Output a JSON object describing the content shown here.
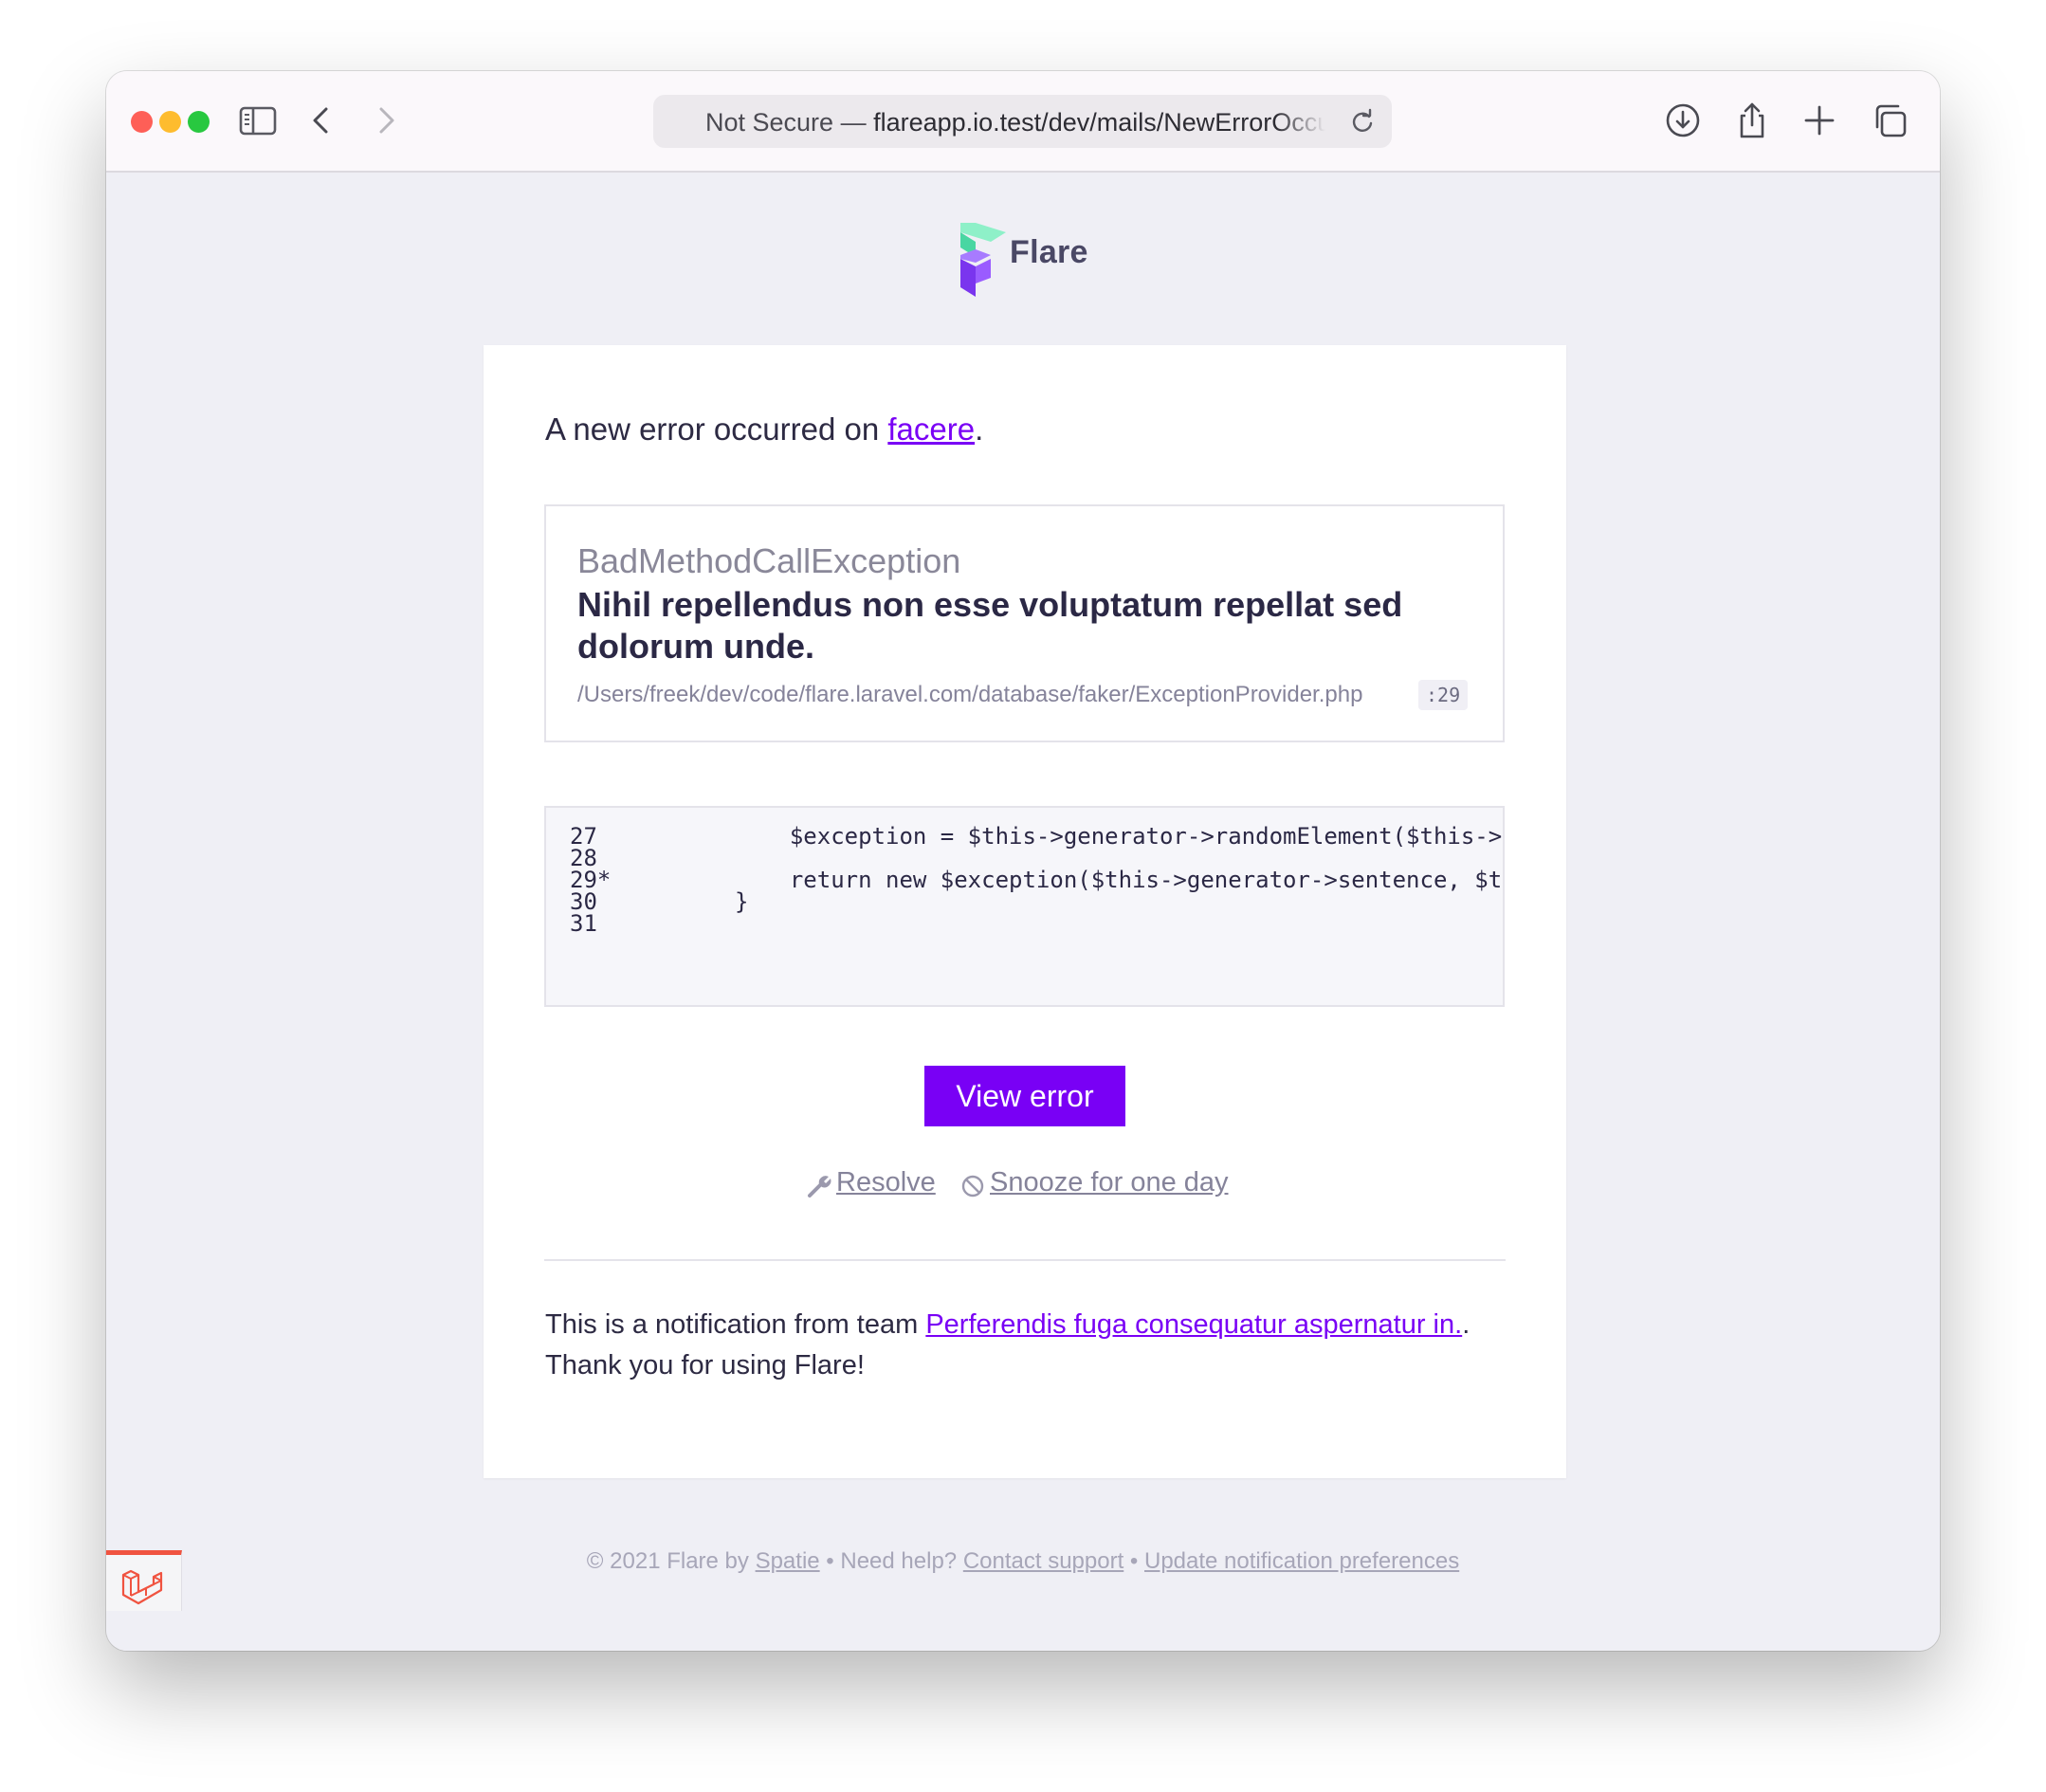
{
  "browser": {
    "address_prefix": "Not Secure — ",
    "address_host": "flareapp.io.test/dev/mails/NewErrorOccu"
  },
  "brand": {
    "name": "Flare"
  },
  "email": {
    "intro_prefix": "A new error occurred on ",
    "intro_link": "facere",
    "intro_suffix": ".",
    "exception": {
      "class": "BadMethodCallException",
      "message": "Nihil repellendus non esse voluptatum repellat sed dolorum unde.",
      "file": "/Users/freek/dev/code/flare.laravel.com/database/faker/ExceptionProvider.php",
      "line": ":29"
    },
    "code_snippet": [
      {
        "num": "27",
        "code": "        $exception = $this->generator->randomElement($this->pos"
      },
      {
        "num": "28",
        "code": ""
      },
      {
        "num": "29*",
        "code": "        return new $exception($this->generator->sentence, $this-"
      },
      {
        "num": "30",
        "code": "    }"
      },
      {
        "num": "31",
        "code": ""
      }
    ],
    "view_button": "View error",
    "resolve_label": "Resolve",
    "snooze_label": "Snooze for one day",
    "team_prefix": "This is a notification from team ",
    "team_link": "Perferendis fuga consequatur aspernatur in.",
    "team_suffix": ".",
    "thanks": "Thank you for using Flare!"
  },
  "legal": {
    "copyright": "© 2021 Flare by ",
    "spatie": "Spatie",
    "sep1": " • Need help? ",
    "contact": "Contact support",
    "sep2": " • ",
    "prefs": "Update notification preferences"
  },
  "colors": {
    "accent": "#7900f5",
    "close": "#fe5f57",
    "minimize": "#febc2e",
    "zoom": "#28c840",
    "laravel": "#f05340"
  }
}
